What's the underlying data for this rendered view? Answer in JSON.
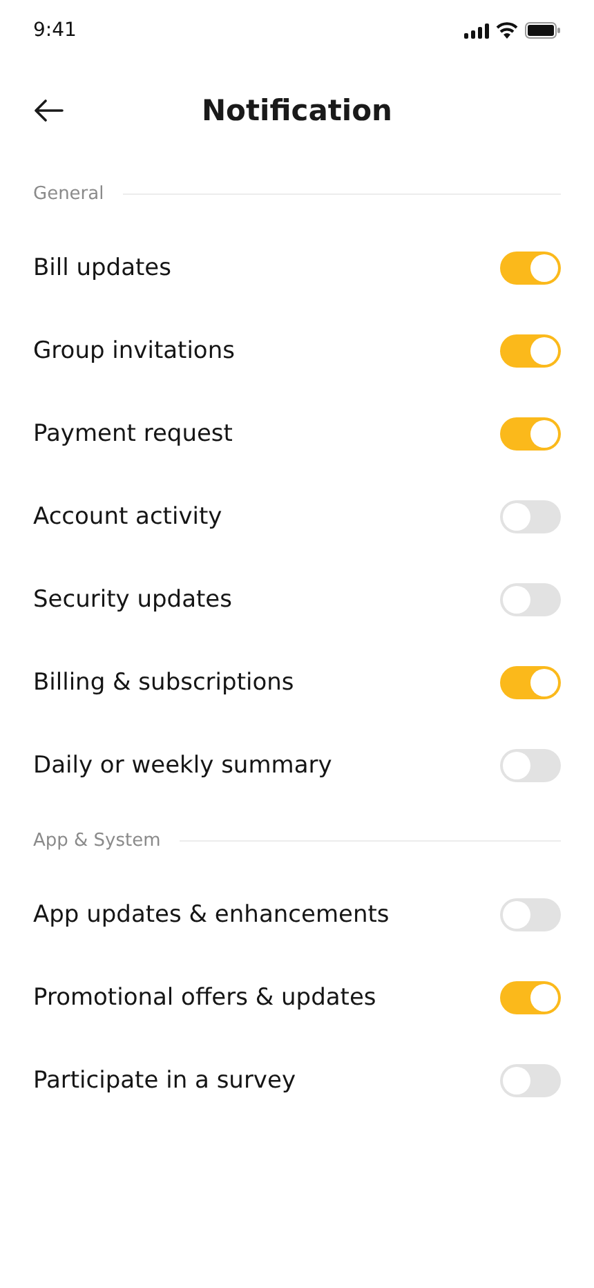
{
  "status_bar": {
    "time": "9:41"
  },
  "header": {
    "title": "Notification"
  },
  "sections": [
    {
      "title": "General",
      "items": [
        {
          "label": "Bill updates",
          "on": true
        },
        {
          "label": "Group invitations",
          "on": true
        },
        {
          "label": "Payment request",
          "on": true
        },
        {
          "label": "Account activity",
          "on": false
        },
        {
          "label": "Security updates",
          "on": false
        },
        {
          "label": "Billing & subscriptions",
          "on": true
        },
        {
          "label": "Daily or weekly summary",
          "on": false
        }
      ]
    },
    {
      "title": "App & System",
      "items": [
        {
          "label": "App updates & enhancements",
          "on": false
        },
        {
          "label": "Promotional offers & updates",
          "on": true
        },
        {
          "label": "Participate in a survey",
          "on": false
        }
      ]
    }
  ]
}
